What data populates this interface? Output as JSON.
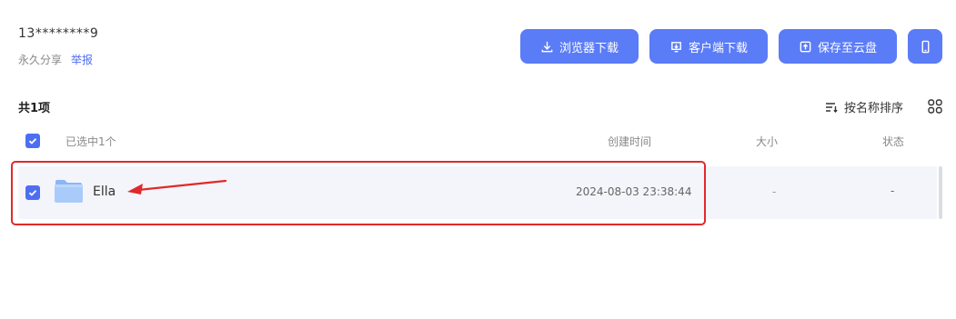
{
  "share": {
    "owner": "13********9",
    "type_label": "永久分享",
    "report_label": "举报"
  },
  "toolbar": {
    "browser_download": "浏览器下载",
    "client_download": "客户端下载",
    "save_to_cloud": "保存至云盘",
    "mobile_icon": "phone-icon"
  },
  "list": {
    "count_label": "共1项",
    "sort_label": "按名称排序",
    "columns": {
      "selected": "已选中1个",
      "created": "创建时间",
      "size": "大小",
      "status": "状态"
    },
    "rows": [
      {
        "name": "Ella",
        "created": "2024-08-03 23:38:44",
        "size": "-",
        "status": "-",
        "checked": true,
        "icon": "folder-icon"
      }
    ]
  },
  "colors": {
    "accent": "#5b7cf7",
    "checkbox": "#4e6ef2",
    "highlight": "#e0292b",
    "row_bg": "#f4f5fb"
  }
}
